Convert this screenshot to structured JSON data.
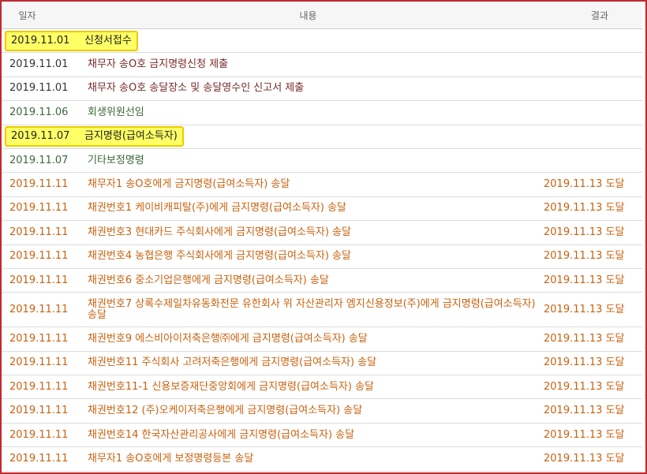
{
  "header": {
    "date": "일자",
    "content": "내용",
    "result": "결과"
  },
  "colors": {
    "frame": "#c0282f",
    "highlight": "#ffff66",
    "dark": "#7a2a2a",
    "green": "#3b6a3b",
    "orange": "#c8620f"
  },
  "rows": [
    {
      "date": "2019.11.01",
      "content": "신청서접수",
      "result": "",
      "style": "dark",
      "highlighted": true
    },
    {
      "date": "2019.11.01",
      "content": "채무자 송O호 금지명령신청 제출",
      "result": "",
      "style": "dark",
      "highlighted": false
    },
    {
      "date": "2019.11.01",
      "content": "채무자 송O호 송달장소 및 송달영수인 신고서 제출",
      "result": "",
      "style": "dark",
      "highlighted": false
    },
    {
      "date": "2019.11.06",
      "content": "회생위원선임",
      "result": "",
      "style": "green",
      "highlighted": false
    },
    {
      "date": "2019.11.07",
      "content": "금지명령(급여소득자)",
      "result": "",
      "style": "green",
      "highlighted": true
    },
    {
      "date": "2019.11.07",
      "content": "기타보정명령",
      "result": "",
      "style": "green",
      "highlighted": false
    },
    {
      "date": "2019.11.11",
      "content": "채무자1 송O호에게 금지명령(급여소득자) 송달",
      "result": "2019.11.13 도달",
      "style": "orange",
      "highlighted": false
    },
    {
      "date": "2019.11.11",
      "content": "채권번호1 케이비캐피탈(주)에게 금지명령(급여소득자) 송달",
      "result": "2019.11.13 도달",
      "style": "orange",
      "highlighted": false
    },
    {
      "date": "2019.11.11",
      "content": "채권번호3 현대카드 주식회사에게 금지명령(급여소득자) 송달",
      "result": "2019.11.13 도달",
      "style": "orange",
      "highlighted": false
    },
    {
      "date": "2019.11.11",
      "content": "채권번호4 농협은행 주식회사에게 금지명령(급여소득자) 송달",
      "result": "2019.11.13 도달",
      "style": "orange",
      "highlighted": false
    },
    {
      "date": "2019.11.11",
      "content": "채권번호6 중소기업은행에게 금지명령(급여소득자) 송달",
      "result": "2019.11.13 도달",
      "style": "orange",
      "highlighted": false
    },
    {
      "date": "2019.11.11",
      "content": "채권번호7 상록수제일차유동화전문 유한회사 위 자산관리자 엠지신용정보(주)에게 금지명령(급여소득자) 송달",
      "result": "2019.11.13 도달",
      "style": "orange",
      "highlighted": false,
      "tall": true
    },
    {
      "date": "2019.11.11",
      "content": "채권번호9 에스비아이저축은행㈜에게 금지명령(급여소득자) 송달",
      "result": "2019.11.13 도달",
      "style": "orange",
      "highlighted": false
    },
    {
      "date": "2019.11.11",
      "content": "채권번호11 주식회사 고려저축은행에게 금지명령(급여소득자) 송달",
      "result": "2019.11.13 도달",
      "style": "orange",
      "highlighted": false
    },
    {
      "date": "2019.11.11",
      "content": "채권번호11-1 신용보증재단중앙회에게 금지명령(급여소득자) 송달",
      "result": "2019.11.13 도달",
      "style": "orange",
      "highlighted": false
    },
    {
      "date": "2019.11.11",
      "content": "채권번호12 (주)오케이저축은행에게 금지명령(급여소득자) 송달",
      "result": "2019.11.13 도달",
      "style": "orange",
      "highlighted": false
    },
    {
      "date": "2019.11.11",
      "content": "채권번호14 한국자산관리공사에게 금지명령(급여소득자) 송달",
      "result": "2019.11.13 도달",
      "style": "orange",
      "highlighted": false
    },
    {
      "date": "2019.11.11",
      "content": "채무자1 송O호에게 보정명령등본 송달",
      "result": "2019.11.13 도달",
      "style": "orange",
      "highlighted": false
    }
  ]
}
